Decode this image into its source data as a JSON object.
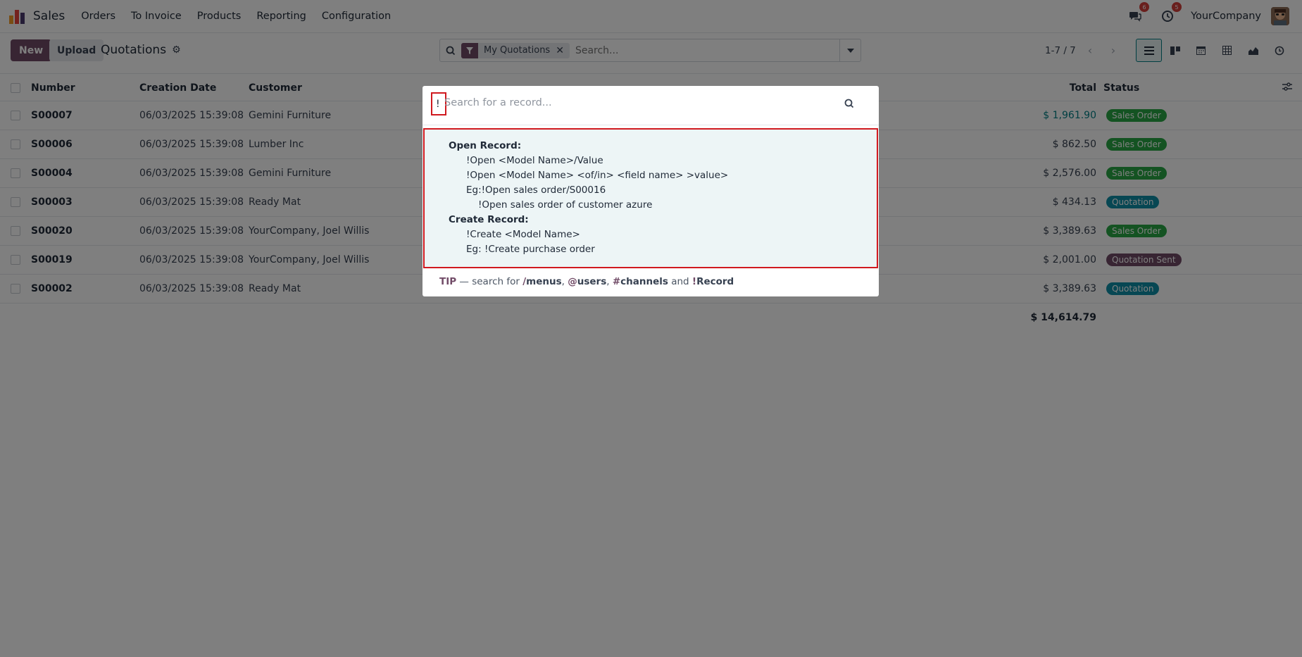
{
  "app": {
    "name": "Sales"
  },
  "menu": [
    "Orders",
    "To Invoice",
    "Products",
    "Reporting",
    "Configuration"
  ],
  "systray": {
    "messages_count": "6",
    "activities_count": "5",
    "company": "YourCompany"
  },
  "control": {
    "new_label": "New",
    "upload_label": "Upload",
    "title": "Quotations",
    "facet_label": "My Quotations",
    "search_placeholder": "Search...",
    "pager": "1-7 / 7"
  },
  "table": {
    "headers": {
      "number": "Number",
      "date": "Creation Date",
      "customer": "Customer",
      "total": "Total",
      "status": "Status"
    },
    "rows": [
      {
        "number": "S00007",
        "date": "06/03/2025 15:39:08",
        "customer": "Gemini Furniture",
        "total": "$ 1,961.90",
        "status": "Sales Order"
      },
      {
        "number": "S00006",
        "date": "06/03/2025 15:39:08",
        "customer": "Lumber Inc",
        "total": "$ 862.50",
        "status": "Sales Order"
      },
      {
        "number": "S00004",
        "date": "06/03/2025 15:39:08",
        "customer": "Gemini Furniture",
        "total": "$ 2,576.00",
        "status": "Sales Order"
      },
      {
        "number": "S00003",
        "date": "06/03/2025 15:39:08",
        "customer": "Ready Mat",
        "total": "$ 434.13",
        "status": "Quotation"
      },
      {
        "number": "S00020",
        "date": "06/03/2025 15:39:08",
        "customer": "YourCompany, Joel Willis",
        "total": "$ 3,389.63",
        "status": "Sales Order"
      },
      {
        "number": "S00019",
        "date": "06/03/2025 15:39:08",
        "customer": "YourCompany, Joel Willis",
        "total": "$ 2,001.00",
        "status": "Quotation Sent"
      },
      {
        "number": "S00002",
        "date": "06/03/2025 15:39:08",
        "customer": "Ready Mat",
        "total": "$ 3,389.63",
        "status": "Quotation"
      }
    ],
    "sum_total": "$ 14,614.79"
  },
  "colors": {
    "sales_order": "#28a745",
    "quotation": "#0f8ea6",
    "quotation_sent": "#714b67",
    "brand": "#714b67",
    "highlight": "#d0191f"
  },
  "palette": {
    "prefix": "!",
    "placeholder": "Search for a record...",
    "help": [
      "Open Record:",
      "!Open <Model Name>/Value",
      "!Open <Model Name> <of/in> <field name> >value>",
      "Eg:!Open sales order/S00016",
      "!Open sales order of customer azure",
      "Create Record:",
      "!Create <Model Name>",
      "Eg: !Create purchase order"
    ],
    "tip_prefix": "TIP",
    "tip_dash": " — search for ",
    "tip_menus": "menus",
    "tip_users": "users",
    "tip_channels": "channels",
    "tip_and": " and ",
    "tip_record": "Record"
  }
}
